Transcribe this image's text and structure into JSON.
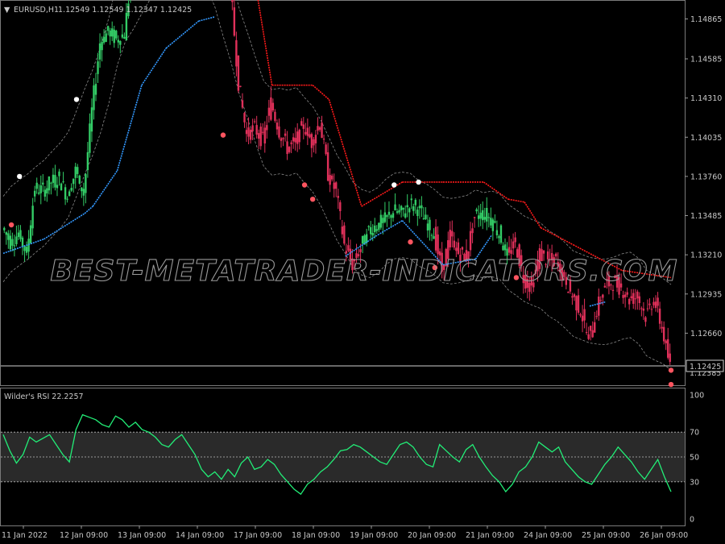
{
  "header": {
    "menu_arrow": "▼",
    "symbol": "EURUSD,H1",
    "ohlc": "1.12549 1.12549 1.12347 1.12425"
  },
  "price_axis": {
    "ticks": [
      "1.14865",
      "1.14585",
      "1.14310",
      "1.14035",
      "1.13760",
      "1.13485",
      "1.13210",
      "1.12935",
      "1.12660"
    ],
    "current_price": "1.12425",
    "partial_label": "1.12385"
  },
  "indicator": {
    "title": "Wilder's RSI 22.2257",
    "levels": [
      "100",
      "70",
      "50",
      "30",
      "0"
    ]
  },
  "time_axis": {
    "labels": [
      "11 Jan 2022",
      "12 Jan 09:00",
      "13 Jan 09:00",
      "14 Jan 09:00",
      "17 Jan 09:00",
      "18 Jan 09:00",
      "19 Jan 09:00",
      "20 Jan 09:00",
      "21 Jan 09:00",
      "24 Jan 09:00",
      "25 Jan 09:00",
      "26 Jan 09:00"
    ]
  },
  "watermark": "BEST-METATRADER-INDICATORS.COM",
  "colors": {
    "background": "#000000",
    "bull_candle": "#33cc66",
    "bear_candle": "#e0305a",
    "trail_up": "#3399ff",
    "trail_down": "#ff1a1a",
    "rsi_line": "#22ee77",
    "band": "#8a8a8a",
    "grid_text": "#c8c8c8"
  },
  "chart_data": {
    "type": "line",
    "price_series": {
      "x_index": [
        0,
        1,
        2,
        3,
        4,
        5,
        6,
        7,
        8,
        9,
        10,
        11,
        12,
        13,
        14,
        15,
        16,
        17,
        18,
        19,
        20,
        21,
        22,
        23,
        24,
        25,
        26,
        27,
        28,
        29,
        30,
        31,
        32,
        33,
        34,
        35,
        36,
        37,
        38,
        39,
        40,
        41,
        42,
        43,
        44,
        45,
        46,
        47,
        48,
        49,
        50,
        51,
        52,
        53,
        54,
        55,
        56,
        57,
        58,
        59,
        60,
        61,
        62,
        63,
        64,
        65,
        66,
        67,
        68,
        69,
        70,
        71,
        72,
        73,
        74,
        75,
        76,
        77,
        78,
        79,
        80,
        81,
        82
      ],
      "close": [
        1.134,
        1.133,
        1.1336,
        1.1322,
        1.1368,
        1.1366,
        1.1372,
        1.1375,
        1.1362,
        1.138,
        1.1364,
        1.1422,
        1.147,
        1.1478,
        1.1472,
        1.1476,
        1.1524,
        1.1545,
        1.154,
        1.1532,
        1.1552,
        1.154,
        1.1537,
        1.1548,
        1.1542,
        1.1555,
        1.1545,
        1.1532,
        1.151,
        1.1442,
        1.1405,
        1.141,
        1.1401,
        1.1428,
        1.1408,
        1.1396,
        1.14,
        1.1412,
        1.14,
        1.1415,
        1.1378,
        1.1365,
        1.1328,
        1.1314,
        1.1326,
        1.1338,
        1.1342,
        1.1345,
        1.1352,
        1.135,
        1.1356,
        1.1354,
        1.1344,
        1.1336,
        1.131,
        1.1334,
        1.1322,
        1.132,
        1.1348,
        1.135,
        1.1346,
        1.1336,
        1.132,
        1.133,
        1.1305,
        1.1298,
        1.1322,
        1.1316,
        1.1318,
        1.1304,
        1.1292,
        1.1282,
        1.1262,
        1.1282,
        1.13,
        1.1302,
        1.1298,
        1.129,
        1.1292,
        1.1278,
        1.129,
        1.127,
        1.12425
      ]
    },
    "trail_up": [
      [
        0,
        1.1322
      ],
      [
        5,
        1.1332
      ],
      [
        10,
        1.135
      ],
      [
        11,
        1.1355
      ],
      [
        14,
        1.138
      ],
      [
        17,
        1.144
      ],
      [
        20,
        1.1466
      ],
      [
        24,
        1.1485
      ],
      [
        26,
        1.1488
      ],
      [
        42,
        1.132
      ],
      [
        46,
        1.1335
      ],
      [
        49,
        1.1345
      ],
      [
        54,
        1.1314
      ],
      [
        58,
        1.1318
      ],
      [
        60,
        1.1335
      ],
      [
        72,
        1.1285
      ],
      [
        74,
        1.1288
      ]
    ],
    "trail_down": [
      [
        26,
        1.1545
      ],
      [
        30,
        1.1545
      ],
      [
        33,
        1.144
      ],
      [
        38,
        1.144
      ],
      [
        40,
        1.143
      ],
      [
        44,
        1.1355
      ],
      [
        49,
        1.1372
      ],
      [
        54,
        1.1372
      ],
      [
        59,
        1.1372
      ],
      [
        62,
        1.136
      ],
      [
        64,
        1.1358
      ],
      [
        66,
        1.134
      ],
      [
        70,
        1.1328
      ],
      [
        76,
        1.131
      ],
      [
        82,
        1.1305
      ]
    ],
    "signal_dots_white": [
      [
        2,
        1.1376
      ],
      [
        9,
        1.143
      ],
      [
        48,
        1.137
      ],
      [
        51,
        1.1372
      ]
    ],
    "signal_dots_red": [
      [
        1,
        1.1342
      ],
      [
        27,
        1.1405
      ],
      [
        37,
        1.137
      ],
      [
        38,
        1.136
      ],
      [
        50,
        1.133
      ],
      [
        53,
        1.1312
      ],
      [
        63,
        1.1305
      ],
      [
        82,
        1.124
      ],
      [
        82,
        1.123
      ]
    ],
    "rsi": {
      "title": "Wilder's RSI 22.2257",
      "values": [
        68,
        55,
        45,
        52,
        66,
        62,
        65,
        68,
        60,
        52,
        46,
        72,
        84,
        82,
        80,
        76,
        74,
        83,
        80,
        74,
        78,
        72,
        70,
        66,
        60,
        58,
        64,
        68,
        60,
        52,
        40,
        34,
        38,
        32,
        40,
        34,
        45,
        50,
        40,
        42,
        48,
        44,
        36,
        30,
        24,
        20,
        28,
        32,
        38,
        42,
        48,
        55,
        56,
        60,
        58,
        54,
        50,
        46,
        44,
        52,
        60,
        62,
        58,
        50,
        44,
        42,
        60,
        55,
        50,
        46,
        56,
        60,
        50,
        42,
        35,
        30,
        22,
        28,
        38,
        42,
        50,
        62,
        58,
        54,
        58,
        46,
        40,
        34,
        30,
        28,
        36,
        44,
        50,
        58,
        52,
        46,
        38,
        32,
        40,
        48,
        34,
        22
      ],
      "ylim": [
        0,
        100
      ],
      "levels": [
        30,
        50,
        70
      ]
    },
    "ylim": [
      1.1234,
      1.1493
    ],
    "xlabel": "",
    "ylabel": ""
  }
}
